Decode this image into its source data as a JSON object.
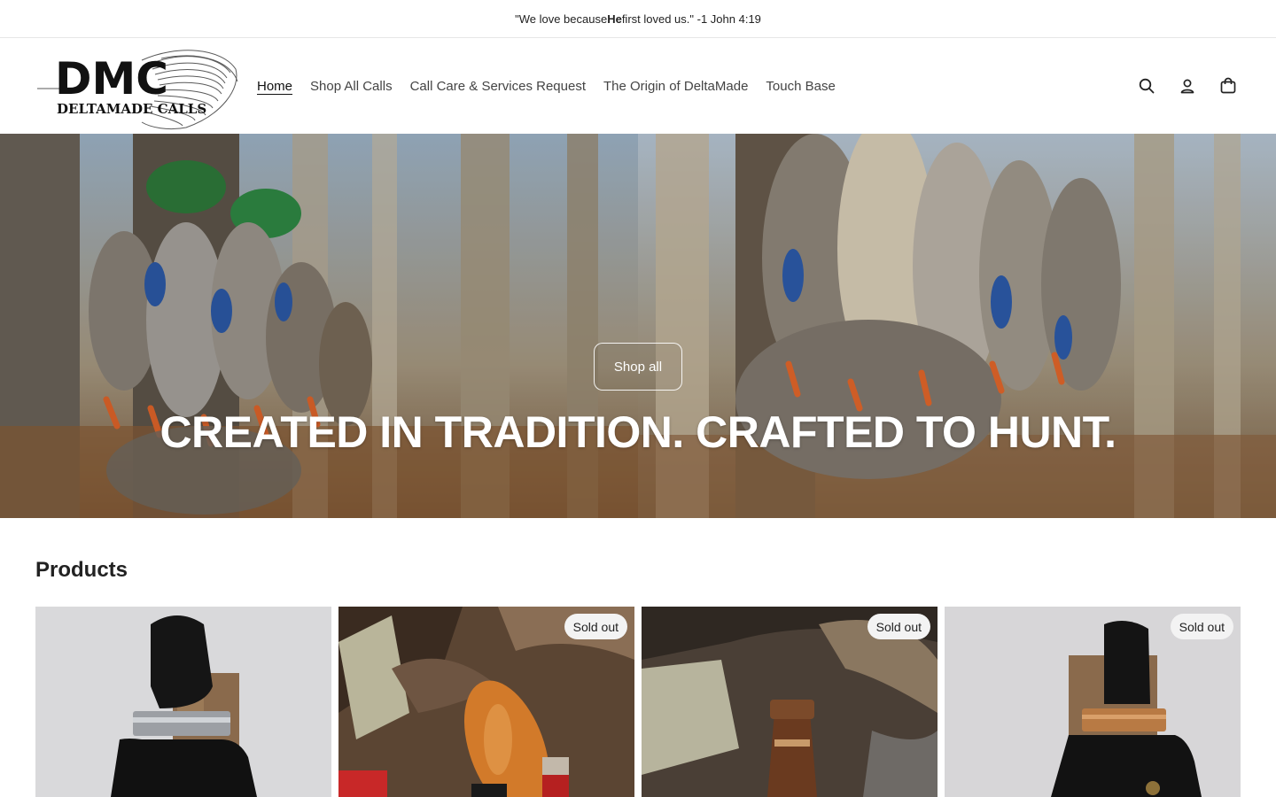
{
  "announcement": {
    "prefix": "\"We love because ",
    "bold": "He",
    "suffix": " first loved us.\" -1 John 4:19"
  },
  "logo": {
    "letters": "DMC",
    "subtitle": "DELTAMADE CALLS"
  },
  "nav": {
    "items": [
      {
        "label": "Home"
      },
      {
        "label": "Shop All Calls"
      },
      {
        "label": "Call Care & Services Request"
      },
      {
        "label": "The Origin of DeltaMade"
      },
      {
        "label": "Touch Base"
      }
    ]
  },
  "header_icons": [
    "search-icon",
    "account-icon",
    "cart-icon"
  ],
  "hero": {
    "button_label": "Shop all",
    "title": "CREATED IN TRADITION. CRAFTED TO HUNT."
  },
  "products": {
    "heading": "Products",
    "items": [
      {
        "badge": ""
      },
      {
        "badge": "Sold out"
      },
      {
        "badge": "Sold out"
      },
      {
        "badge": "Sold out"
      }
    ]
  },
  "colors": {
    "text": "#222222",
    "hero_text": "#ffffff",
    "badge_bg": "#f3f3f3"
  }
}
